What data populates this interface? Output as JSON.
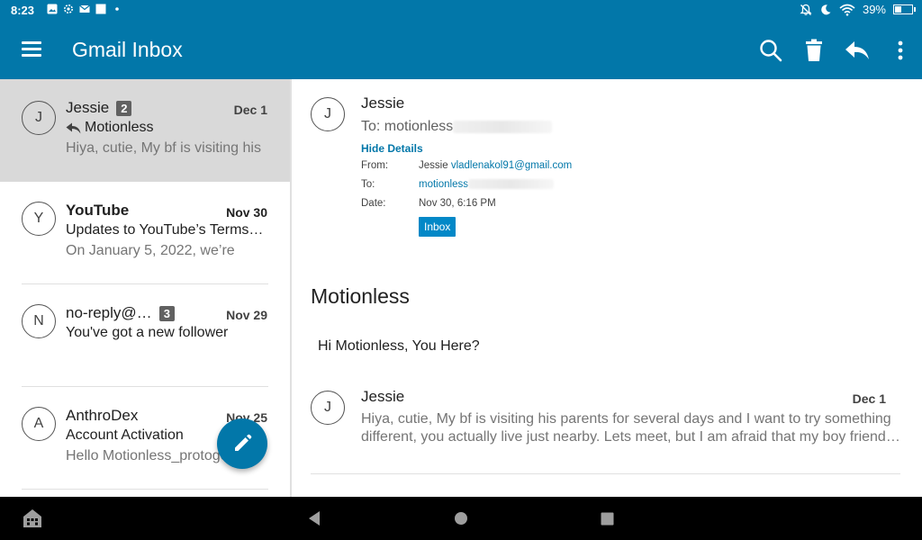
{
  "status_bar": {
    "time": "8:23",
    "battery": "39%",
    "battery_level": 0.39,
    "icons_left": [
      "image-icon",
      "settings-icon",
      "mail-icon",
      "square-icon",
      "dot-icon"
    ],
    "icons_right": [
      "notifications-off-icon",
      "moon-icon",
      "wifi-icon",
      "battery-icon"
    ]
  },
  "app_bar": {
    "title": "Gmail Inbox",
    "actions": [
      "search-icon",
      "delete-icon",
      "reply-icon",
      "overflow-menu-icon"
    ],
    "color": "#0277a9"
  },
  "threads": [
    {
      "avatar": "J",
      "sender": "Jessie",
      "count": "2",
      "date": "Dec 1",
      "subject": "Motionless",
      "snippet": "Hiya, cutie, My bf is visiting his",
      "replied": true,
      "selected": true,
      "unread": false
    },
    {
      "avatar": "Y",
      "sender": "YouTube",
      "count": "",
      "date": "Nov 30",
      "subject": "Updates to YouTube’s Terms…",
      "snippet": "On January 5, 2022, we’re",
      "replied": false,
      "selected": false,
      "unread": true
    },
    {
      "avatar": "N",
      "sender": "no-reply@…",
      "count": "3",
      "date": "Nov 29",
      "subject": "You've got a new follower",
      "snippet": "",
      "replied": false,
      "selected": false,
      "unread": false
    },
    {
      "avatar": "A",
      "sender": "AnthroDex",
      "count": "",
      "date": "Nov 25",
      "subject": "Account Activation",
      "snippet": "Hello Motionless_protoge",
      "replied": false,
      "selected": false,
      "unread": false
    }
  ],
  "detail": {
    "avatar": "J",
    "sender": "Jessie",
    "to_line": "To: motionless",
    "hide_details": "Hide Details",
    "from_label": "From:",
    "from_name": "Jessie",
    "from_email": "vladlenakol91@gmail.com",
    "to_label": "To:",
    "to_value": "motionless",
    "date_label": "Date:",
    "date_value": "Nov 30, 6:16 PM",
    "label_chip": "Inbox",
    "subject": "Motionless",
    "body": "Hi Motionless, You Here?",
    "message": {
      "avatar": "J",
      "sender": "Jessie",
      "date": "Dec 1",
      "snippet_line1": "Hiya, cutie, My bf is visiting his parents for several days and I want to try something",
      "snippet_line2": "different, you actually live just nearby. Lets meet, but I am afraid that my boy friend…"
    }
  },
  "fab": {
    "icon": "pencil-icon"
  },
  "nav_bar": {
    "buttons": [
      "home-drawer-icon",
      "back-icon",
      "home-icon",
      "recents-icon"
    ]
  }
}
